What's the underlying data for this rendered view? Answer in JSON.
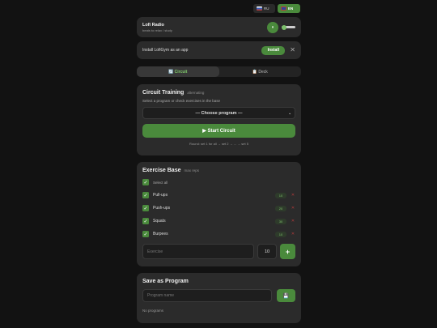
{
  "lang": {
    "ru_label": "RU",
    "en_label": "EN",
    "active": "EN",
    "colors": {
      "ru_flag": "#3a5fb8",
      "en_flag": "#b83a3a"
    }
  },
  "radio": {
    "title": "Lofi Radio",
    "subtitle": "beats to relax / study",
    "play_icon": "play-icon"
  },
  "install": {
    "text": "Install LofiGym as an app",
    "button_label": "Install",
    "close_glyph": "✕"
  },
  "tabs": [
    {
      "icon": "🔄",
      "label": "Circuit",
      "active": true
    },
    {
      "icon": "📋",
      "label": "Deck",
      "active": false
    }
  ],
  "circuit": {
    "title": "Circuit Training",
    "badge": "alternating",
    "hint": "Select a program or check exercises in the base",
    "select_value": "— Choose program —",
    "start_label": "▶ Start Circuit",
    "rounds_text": "Round: set 1 for all → set 2 → ... → set 5"
  },
  "base": {
    "title": "Exercise Base",
    "badge": "max reps",
    "select_all_label": "Select all",
    "exercises": [
      {
        "name": "Pull-ups",
        "reps": "10",
        "checked": true
      },
      {
        "name": "Push-ups",
        "reps": "20",
        "checked": true
      },
      {
        "name": "Squats",
        "reps": "30",
        "checked": true
      },
      {
        "name": "Burpees",
        "reps": "10",
        "checked": true
      }
    ],
    "exercise_placeholder": "Exercise",
    "reps_default": "10",
    "add_glyph": "+"
  },
  "save": {
    "title": "Save as Program",
    "name_placeholder": "Program name",
    "save_glyph": "💾",
    "empty_text": "No programs"
  },
  "colors": {
    "accent": "#4a8a3c",
    "background": "#121212",
    "card": "#2b2b2b",
    "delete": "#b03a3a"
  }
}
